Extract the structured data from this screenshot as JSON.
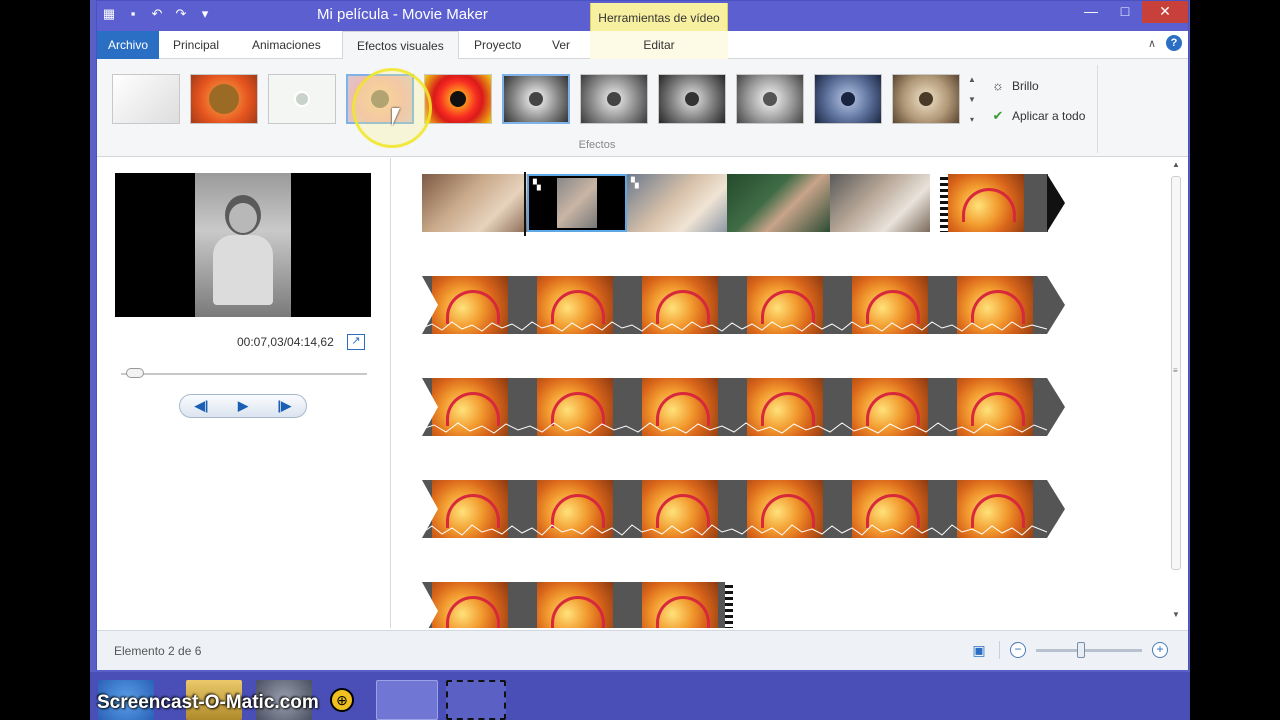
{
  "titlebar": {
    "title": "Mi película - Movie Maker",
    "context_tab": "Herramientas de vídeo",
    "minimize": "—",
    "maximize": "□",
    "close": "✕"
  },
  "tabs": {
    "file": "Archivo",
    "items": [
      "Principal",
      "Animaciones",
      "Efectos visuales",
      "Proyecto",
      "Ver"
    ],
    "context": "Editar"
  },
  "ribbon": {
    "group_label": "Efectos",
    "brightness": "Brillo",
    "apply_all": "Aplicar a todo"
  },
  "preview": {
    "timecode": "00:07,03/04:14,62",
    "seek_fraction": 0.03
  },
  "status": {
    "text": "Elemento 2 de 6",
    "zoom_fraction": 0.42
  },
  "watermark": {
    "text": "Screencast-O-Matic.com"
  }
}
